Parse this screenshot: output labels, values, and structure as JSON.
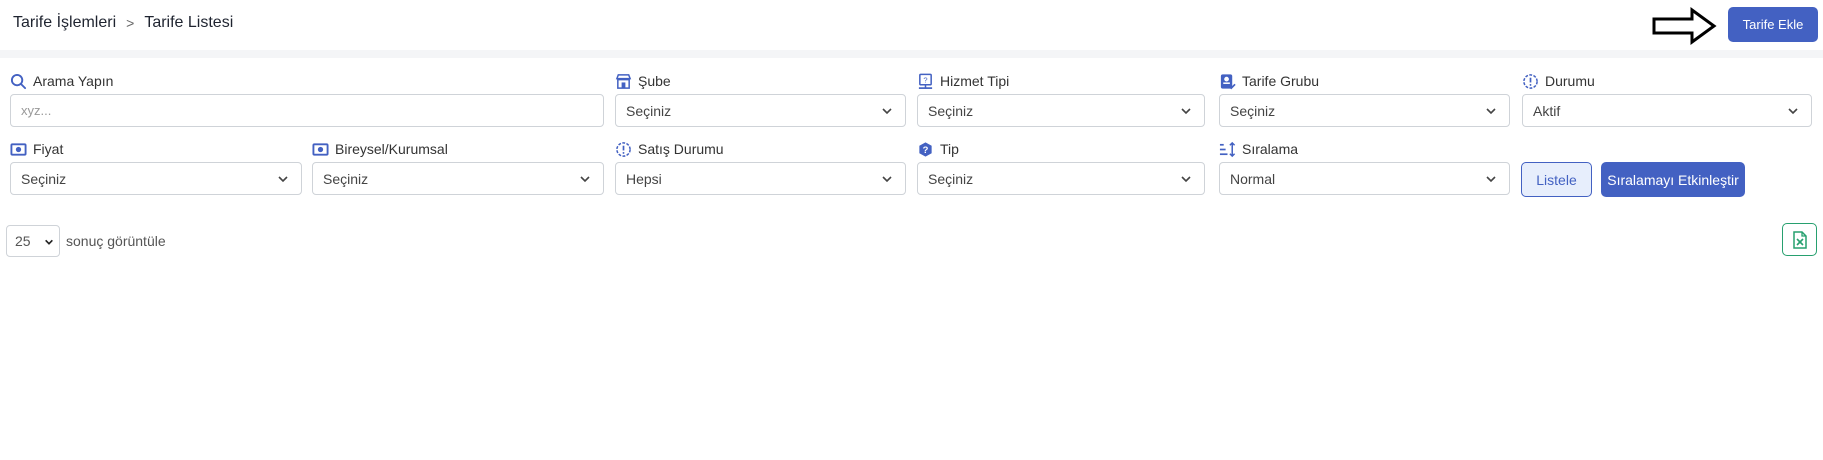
{
  "breadcrumb": {
    "parent": "Tarife İşlemleri",
    "current": "Tarife Listesi"
  },
  "header": {
    "add_button": "Tarife Ekle"
  },
  "filters": {
    "search": {
      "label": "Arama Yapın",
      "placeholder": "xyz..."
    },
    "sube": {
      "label": "Şube",
      "value": "Seçiniz"
    },
    "hizmet_tipi": {
      "label": "Hizmet Tipi",
      "value": "Seçiniz"
    },
    "tarife_grubu": {
      "label": "Tarife Grubu",
      "value": "Seçiniz"
    },
    "durumu": {
      "label": "Durumu",
      "value": "Aktif"
    },
    "fiyat": {
      "label": "Fiyat",
      "value": "Seçiniz"
    },
    "bireysel": {
      "label": "Bireysel/Kurumsal",
      "value": "Seçiniz"
    },
    "satis_durumu": {
      "label": "Satış Durumu",
      "value": "Hepsi"
    },
    "tip": {
      "label": "Tip",
      "value": "Seçiniz"
    },
    "siralama": {
      "label": "Sıralama",
      "value": "Normal"
    }
  },
  "actions": {
    "list_button": "Listele",
    "sort_button": "Sıralamayı Etkinleştir"
  },
  "pager": {
    "page_size": "25",
    "suffix": "sonuç görüntüle"
  },
  "icons": {
    "search": "search-icon",
    "store": "store-icon",
    "service": "service-icon",
    "group": "tariff-group-icon",
    "status": "status-icon",
    "price": "price-icon",
    "question": "question-icon",
    "sort": "sort-icon",
    "excel": "excel-icon"
  },
  "colors": {
    "accent": "#4361c2",
    "excel": "#27a06f",
    "border": "#cfd3d8"
  }
}
